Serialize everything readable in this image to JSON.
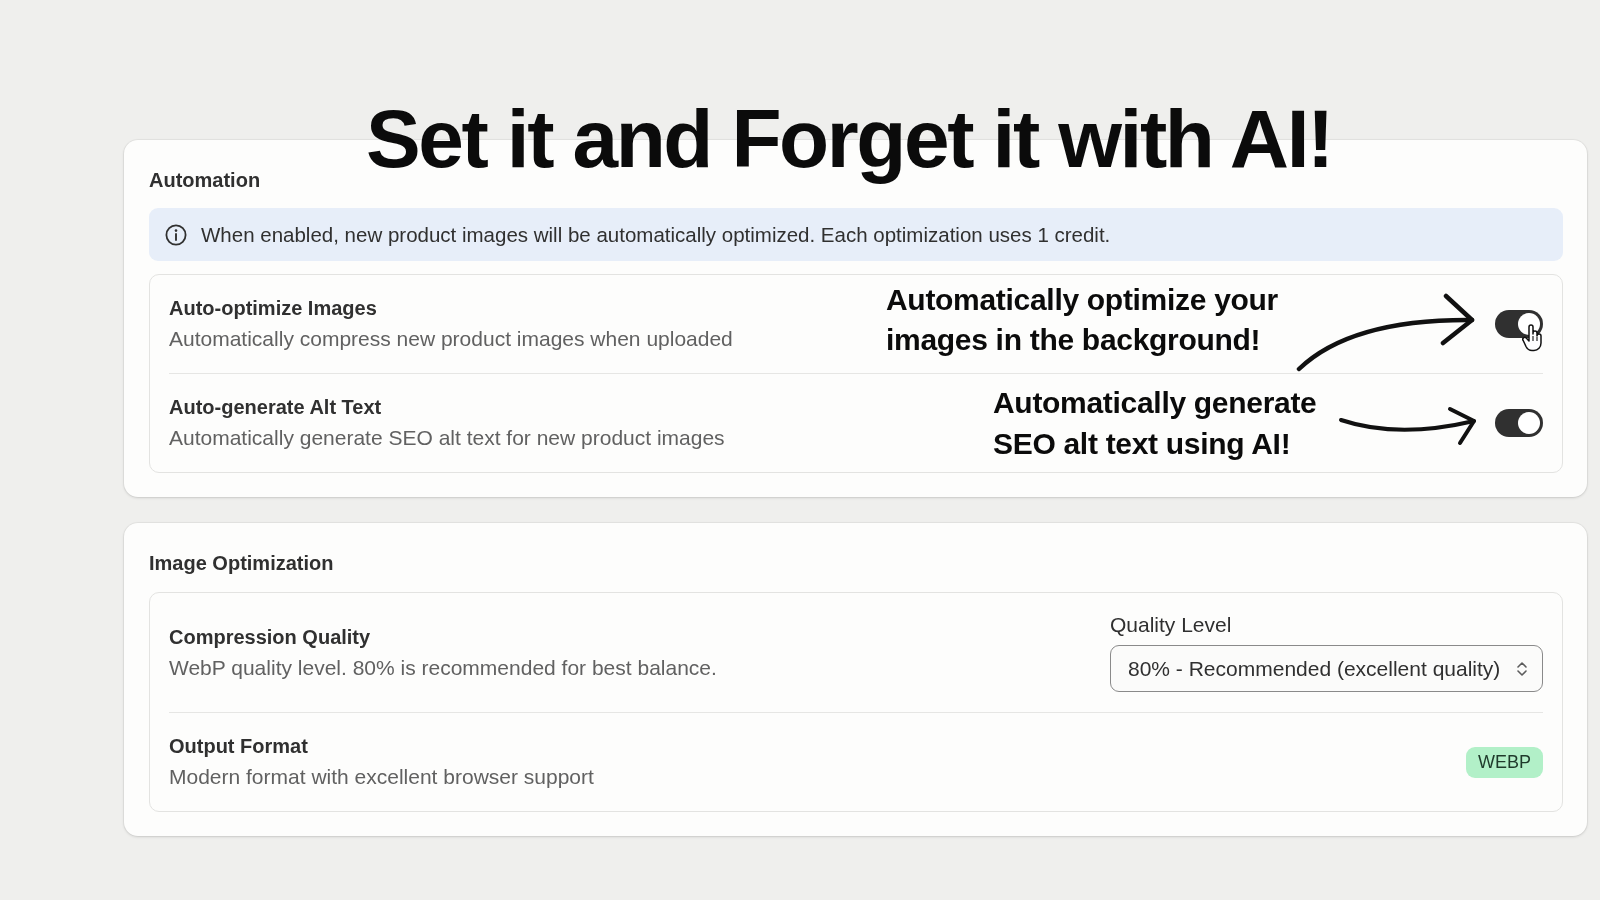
{
  "headline": "Set it and Forget it with AI!",
  "sections": [
    {
      "title": "Automation",
      "banner": {
        "text": "When enabled, new product images will be automatically optimized. Each optimization uses 1 credit."
      },
      "rows": [
        {
          "kind": "toggle",
          "title": "Auto-optimize Images",
          "description": "Automatically compress new product images when uploaded",
          "on": true,
          "pointer": true,
          "annotation": "Automatically optimize your\nimages in the background!"
        },
        {
          "kind": "toggle",
          "title": "Auto-generate Alt Text",
          "description": "Automatically generate SEO alt text for new product images",
          "on": true,
          "pointer": false,
          "annotation": "Automatically generate\nSEO alt text using AI!"
        }
      ]
    },
    {
      "title": "Image Optimization",
      "rows": [
        {
          "kind": "select",
          "title": "Compression Quality",
          "description": "WebP quality level. 80% is recommended for best balance.",
          "select": {
            "label": "Quality Level",
            "value": "80% - Recommended (excellent quality)"
          }
        },
        {
          "kind": "badge",
          "title": "Output Format",
          "description": "Modern format with excellent browser support",
          "badge": "WEBP"
        }
      ]
    }
  ]
}
